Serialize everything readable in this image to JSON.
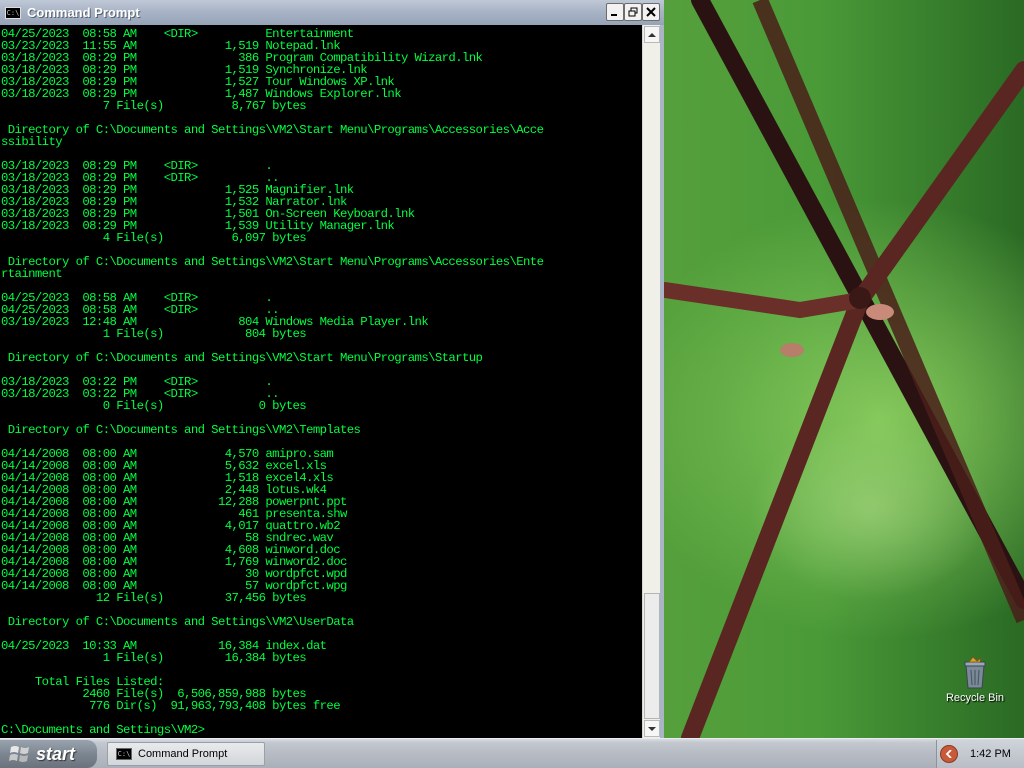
{
  "window": {
    "title": "Command Prompt",
    "icon": "cmd-icon",
    "icon_text": "C:\\",
    "controls": {
      "minimize": "minimize-icon",
      "maximize": "maximize-icon",
      "close": "close-icon"
    }
  },
  "console": {
    "text_color": "#00ff40",
    "background": "#000000",
    "lines": [
      "04/25/2023  08:58 AM    <DIR>          Entertainment",
      "03/23/2023  11:55 AM             1,519 Notepad.lnk",
      "03/18/2023  08:29 PM               386 Program Compatibility Wizard.lnk",
      "03/18/2023  08:29 PM             1,519 Synchronize.lnk",
      "03/18/2023  08:29 PM             1,527 Tour Windows XP.lnk",
      "03/18/2023  08:29 PM             1,487 Windows Explorer.lnk",
      "               7 File(s)          8,767 bytes",
      "",
      " Directory of C:\\Documents and Settings\\VM2\\Start Menu\\Programs\\Accessories\\Acce",
      "ssibility",
      "",
      "03/18/2023  08:29 PM    <DIR>          .",
      "03/18/2023  08:29 PM    <DIR>          ..",
      "03/18/2023  08:29 PM             1,525 Magnifier.lnk",
      "03/18/2023  08:29 PM             1,532 Narrator.lnk",
      "03/18/2023  08:29 PM             1,501 On-Screen Keyboard.lnk",
      "03/18/2023  08:29 PM             1,539 Utility Manager.lnk",
      "               4 File(s)          6,097 bytes",
      "",
      " Directory of C:\\Documents and Settings\\VM2\\Start Menu\\Programs\\Accessories\\Ente",
      "rtainment",
      "",
      "04/25/2023  08:58 AM    <DIR>          .",
      "04/25/2023  08:58 AM    <DIR>          ..",
      "03/19/2023  12:48 AM               804 Windows Media Player.lnk",
      "               1 File(s)            804 bytes",
      "",
      " Directory of C:\\Documents and Settings\\VM2\\Start Menu\\Programs\\Startup",
      "",
      "03/18/2023  03:22 PM    <DIR>          .",
      "03/18/2023  03:22 PM    <DIR>          ..",
      "               0 File(s)              0 bytes",
      "",
      " Directory of C:\\Documents and Settings\\VM2\\Templates",
      "",
      "04/14/2008  08:00 AM             4,570 amipro.sam",
      "04/14/2008  08:00 AM             5,632 excel.xls",
      "04/14/2008  08:00 AM             1,518 excel4.xls",
      "04/14/2008  08:00 AM             2,448 lotus.wk4",
      "04/14/2008  08:00 AM            12,288 powerpnt.ppt",
      "04/14/2008  08:00 AM               461 presenta.shw",
      "04/14/2008  08:00 AM             4,017 quattro.wb2",
      "04/14/2008  08:00 AM                58 sndrec.wav",
      "04/14/2008  08:00 AM             4,608 winword.doc",
      "04/14/2008  08:00 AM             1,769 winword2.doc",
      "04/14/2008  08:00 AM                30 wordpfct.wpd",
      "04/14/2008  08:00 AM                57 wordpfct.wpg",
      "              12 File(s)         37,456 bytes",
      "",
      " Directory of C:\\Documents and Settings\\VM2\\UserData",
      "",
      "04/25/2023  10:33 AM            16,384 index.dat",
      "               1 File(s)         16,384 bytes",
      "",
      "     Total Files Listed:",
      "            2460 File(s)  6,506,859,988 bytes",
      "             776 Dir(s)  91,963,793,408 bytes free",
      "",
      "C:\\Documents and Settings\\VM2>"
    ]
  },
  "scrollbar": {
    "up_icon": "scroll-up-arrow-icon",
    "down_icon": "scroll-down-arrow-icon"
  },
  "desktop": {
    "recycle_bin": {
      "label": "Recycle Bin",
      "icon": "recycle-bin-icon"
    }
  },
  "taskbar": {
    "start_label": "start",
    "start_icon": "windows-flag-icon",
    "tasks": [
      {
        "label": "Command Prompt",
        "icon": "cmd-icon",
        "icon_text": "C:\\"
      }
    ],
    "tray_icon": "show-hidden-icons-arrow-icon",
    "clock": "1:42 PM"
  }
}
